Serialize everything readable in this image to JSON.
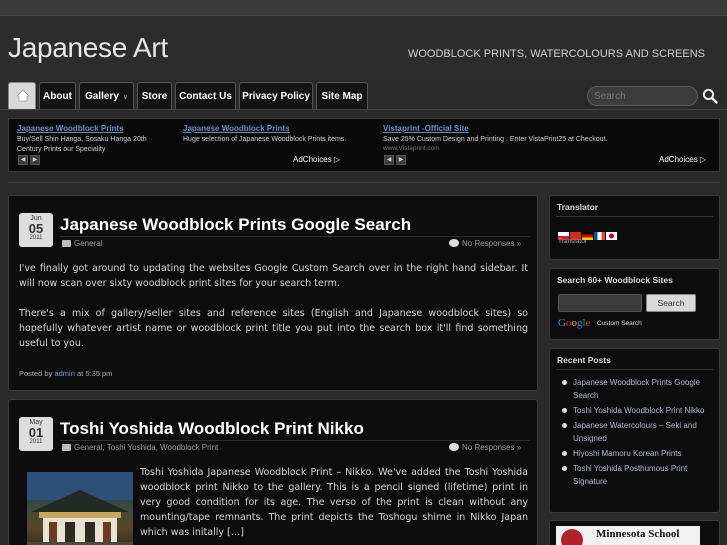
{
  "site": {
    "title": "Japanese Art",
    "tagline": "WOODBLOCK PRINTS, WATERCOLOURS AND SCREENS"
  },
  "nav": {
    "items": [
      {
        "label": "About"
      },
      {
        "label": "Gallery"
      },
      {
        "label": "Store"
      },
      {
        "label": "Contact Us"
      },
      {
        "label": "Privacy Policy"
      },
      {
        "label": "Site Map"
      }
    ]
  },
  "search": {
    "placeholder": "Search"
  },
  "ads": {
    "items": [
      {
        "title": "Japanese Woodblock Prints",
        "text": "Buy/Sell Shin Hanga, Sosaku Hanga 20th Century Prints our Speciality",
        "url": ""
      },
      {
        "title": "Japanese Woodblock Prints",
        "text": "Huge selection of Japanese Woodblock Prints items.",
        "url": ""
      },
      {
        "title": "Vistaprint -Official Site",
        "text": "Save 25% Custom Design and Printing . Enter VistaPrint25 at Checkout.",
        "url": "www.Vistaprint.com"
      }
    ],
    "adchoices_label": "AdChoices"
  },
  "posts": [
    {
      "month": "Jun",
      "day": "05",
      "year": "2011",
      "title": "Japanese Woodblock Prints Google Search",
      "category": "General",
      "comments": "No Responses »",
      "paragraphs": [
        "I've finally got around to updating the websites Google Custom Search over in the right hand sidebar. It will now scan over sixty woodblock print sites for your search term.",
        "There's a mix of gallery/seller sites and reference sites (English and Japanese woodblock sites) so hopefully whatever artist name or woodblock print title you put into the search box it'll find something useful to you."
      ],
      "posted_by_prefix": "Posted by",
      "author": "admin",
      "posted_at": "at 5:35 pm"
    },
    {
      "month": "May",
      "day": "01",
      "year": "2011",
      "title": "Toshi Yoshida Woodblock Print Nikko",
      "category": "General, Toshi Yoshida, Woodblock Print",
      "comments": "No Responses »",
      "excerpt": "Toshi Yoshida Japanese Woodblock Print – Nikko. We've added the Toshi Yoshida woodblock print Nikko to the gallery. This is a pencil signed (lifetime) print in very good condition for its age. The verso of the print is clean without any mounting/tape remnants. The print depicts the Toshogu shirne in Nikko Japan which was initally […]"
    }
  ],
  "sidebar": {
    "translator": {
      "title": "Translator",
      "label": "Translator"
    },
    "search_widget": {
      "title": "Search 60+ Woodblock Sites",
      "button": "Search",
      "custom_search_label": "Custom Search"
    },
    "recent_posts": {
      "title": "Recent Posts",
      "items": [
        "Japanese Woodblock Prints Google Search",
        "Toshi Yoshida Woodblock Print Nikko",
        "Japanese Watercolours – Seki and Unsigned",
        "Hiyoshi Mamoru Korean Prints",
        "Toshi Yoshida Posthumous Print Signature"
      ]
    },
    "ad_widget": {
      "text": "Minnesota School"
    }
  },
  "colors": {
    "background": "#2a2a2a",
    "panel": "#0d0d0d",
    "link": "#7c9cd4"
  }
}
